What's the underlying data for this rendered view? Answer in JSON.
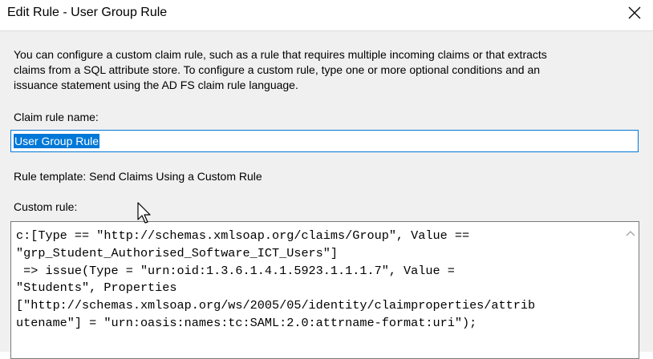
{
  "window": {
    "title": "Edit Rule - User Group Rule"
  },
  "description": "You can configure a custom claim rule, such as a rule that requires multiple incoming claims or that extracts\nclaims from a SQL attribute store. To configure a custom rule, type one or more optional conditions and an\nissuance statement using the AD FS claim rule language.",
  "claim_rule_name": {
    "label": "Claim rule name:",
    "value": "User Group Rule"
  },
  "rule_template": {
    "label": "Rule template: Send Claims Using a Custom Rule"
  },
  "custom_rule": {
    "label": "Custom rule:",
    "text": "c:[Type == \"http://schemas.xmlsoap.org/claims/Group\", Value ==\n\"grp_Student_Authorised_Software_ICT_Users\"]\n => issue(Type = \"urn:oid:1.3.6.1.4.1.5923.1.1.1.7\", Value =\n\"Students\", Properties\n[\"http://schemas.xmlsoap.org/ws/2005/05/identity/claimproperties/attrib\nutename\"] = \"urn:oasis:names:tc:SAML:2.0:attrname-format:uri\");"
  },
  "icons": {
    "close": "close-icon",
    "scroll_up": "chevron-up-icon",
    "cursor": "mouse-pointer-icon"
  },
  "colors": {
    "accent": "#0078d7",
    "dialog_background": "#f0f0f0",
    "scroll_arrow": "#a0a0a0"
  }
}
